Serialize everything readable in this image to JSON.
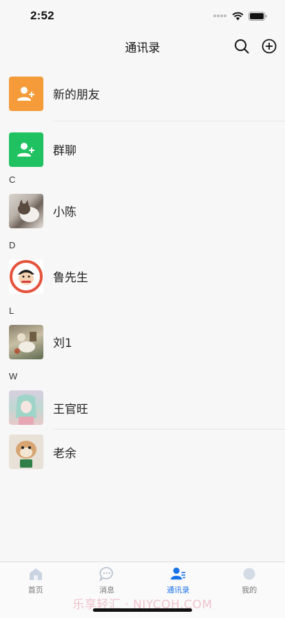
{
  "status": {
    "time": "2:52"
  },
  "nav": {
    "title": "通讯录"
  },
  "contacts": {
    "new_friends": "新的朋友",
    "group_chat": "群聊",
    "sections": [
      {
        "letter": "C",
        "names": [
          "小陈"
        ]
      },
      {
        "letter": "D",
        "names": [
          "鲁先生"
        ]
      },
      {
        "letter": "L",
        "names": [
          "刘1"
        ]
      },
      {
        "letter": "W",
        "names": [
          "王官旺",
          "老余"
        ]
      }
    ]
  },
  "tabs": [
    {
      "label": "首页",
      "icon": "home-icon",
      "active": false
    },
    {
      "label": "消息",
      "icon": "chat-bubble-icon",
      "active": false
    },
    {
      "label": "通讯录",
      "icon": "contacts-icon",
      "active": true
    },
    {
      "label": "我的",
      "icon": "profile-icon",
      "active": false
    }
  ],
  "watermark": "乐享轻汇 · NJYCQH.COM",
  "colors": {
    "new_friends": "#f59b3a",
    "group_chat": "#1fc160",
    "active_tab": "#1a73e8"
  }
}
